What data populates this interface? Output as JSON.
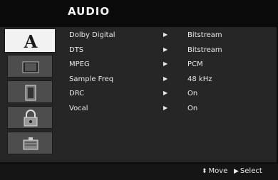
{
  "header": {
    "title": "AUDIO"
  },
  "tabs": [
    {
      "icon": "letter-a-icon",
      "glyph": "A",
      "active": true
    },
    {
      "icon": "screen-icon",
      "active": false
    },
    {
      "icon": "speaker-icon",
      "active": false
    },
    {
      "icon": "lock-icon",
      "active": false
    },
    {
      "icon": "tools-icon",
      "active": false
    }
  ],
  "menu": {
    "items": [
      {
        "label": "Dolby Digital",
        "value": "Bitstream"
      },
      {
        "label": "DTS",
        "value": "Bitstream"
      },
      {
        "label": "MPEG",
        "value": "PCM"
      },
      {
        "label": "Sample Freq",
        "value": "48 kHz"
      },
      {
        "label": "DRC",
        "value": "On"
      },
      {
        "label": "Vocal",
        "value": "On"
      }
    ]
  },
  "footer": {
    "move_label": "Move",
    "select_label": "Select"
  },
  "colors": {
    "background": "#0b0b0b",
    "panel": "#262626",
    "tab_active": "#f2f2f2",
    "tab_inactive": "#4d4d4d"
  }
}
